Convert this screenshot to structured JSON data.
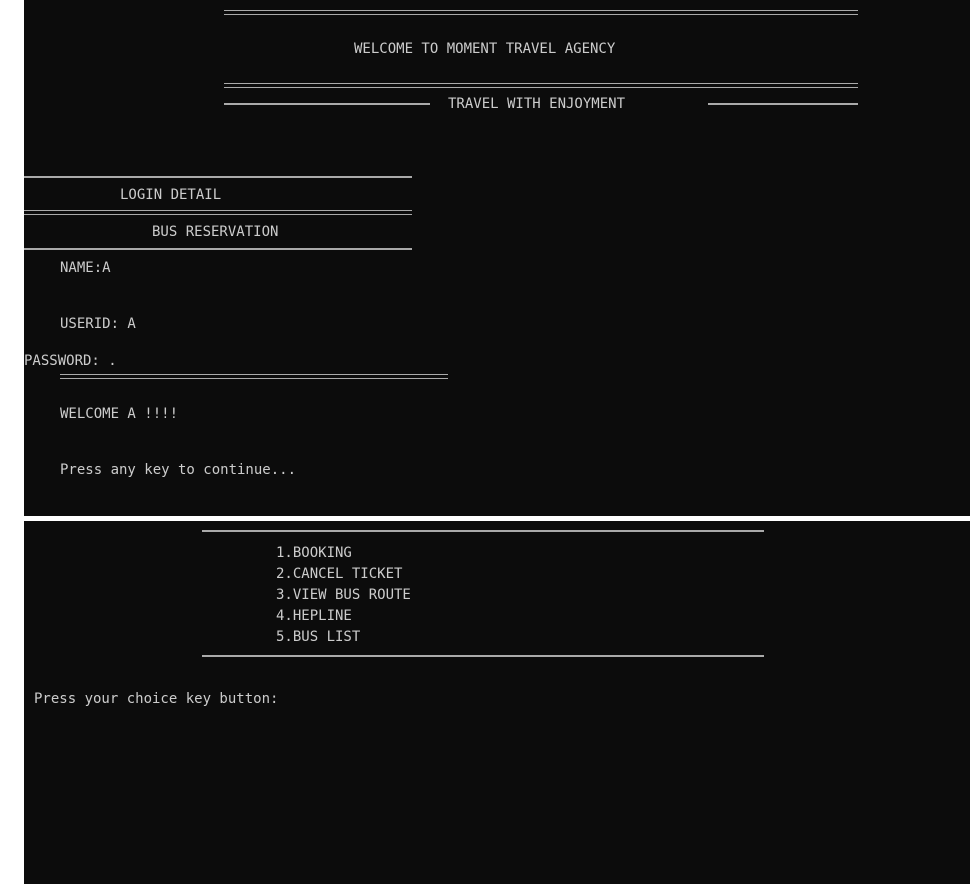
{
  "login_screen": {
    "agency_title": "WELCOME TO MOMENT TRAVEL AGENCY",
    "tagline": "TRAVEL WITH ENJOYMENT",
    "login_detail": "LOGIN DETAIL",
    "bus_reservation": "BUS RESERVATION",
    "name_line": "NAME:A",
    "userid_line": "USERID: A",
    "password_line": "PASSWORD: .",
    "welcome_line": "WELCOME A !!!!",
    "continue_prompt": "Press any key to continue..."
  },
  "menu_screen": {
    "items": [
      "1.BOOKING",
      "2.CANCEL TICKET",
      "3.VIEW BUS ROUTE",
      "4.HEPLINE",
      "5.BUS LIST"
    ],
    "choice_prompt": "Press your choice key button:"
  },
  "colors": {
    "console_background": "#0c0c0c",
    "console_text": "#cccccc",
    "rule_color": "#aaaaaa"
  }
}
